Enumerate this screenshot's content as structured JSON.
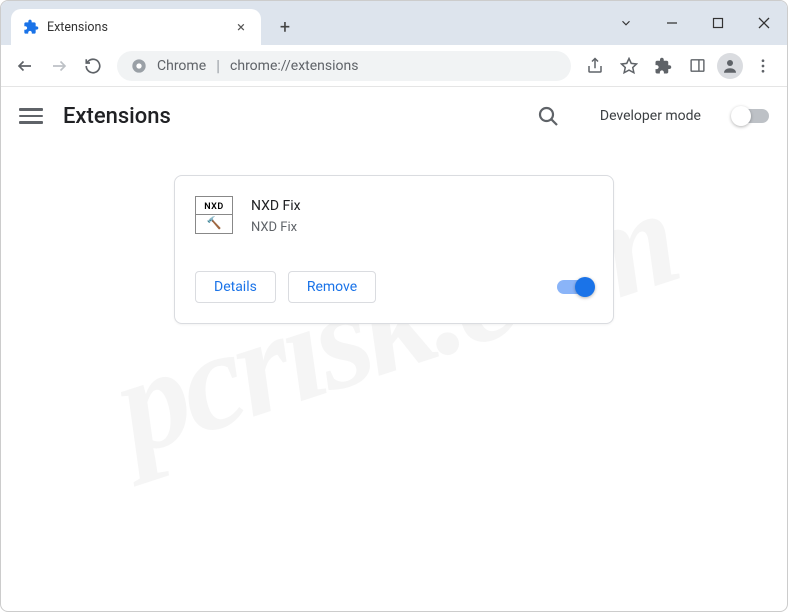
{
  "window": {
    "tab_title": "Extensions"
  },
  "omnibox": {
    "prefix": "Chrome",
    "url": "chrome://extensions"
  },
  "page": {
    "title": "Extensions",
    "developer_mode_label": "Developer mode",
    "developer_mode_enabled": false
  },
  "extension": {
    "name": "NXD Fix",
    "description": "NXD Fix",
    "icon_text": "NXD",
    "enabled": true,
    "details_label": "Details",
    "remove_label": "Remove"
  },
  "watermark": "pcrisk.com"
}
